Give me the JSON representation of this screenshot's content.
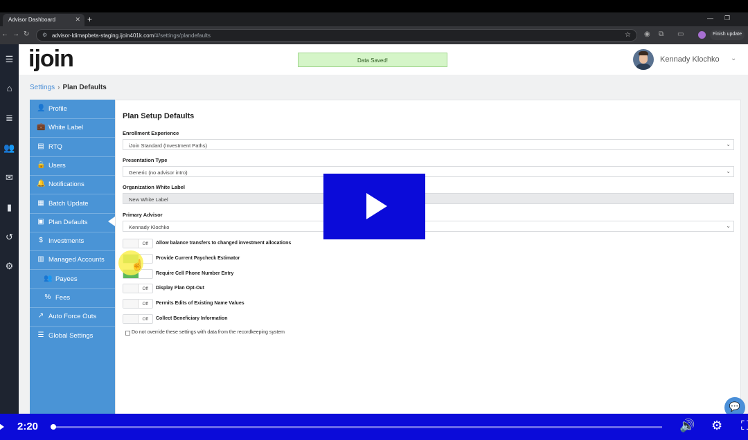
{
  "browser": {
    "tab_title": "Advisor Dashboard",
    "url_host": "advisor-ldimapbeta-staging.ijoin401k.com",
    "url_path": "/#/settings/plandefaults",
    "finish_update": "Finish update"
  },
  "header": {
    "logo": "ijoin",
    "toast": "Data Saved!",
    "user_name": "Kennady Klochko"
  },
  "breadcrumb": {
    "parent": "Settings",
    "separator": "›",
    "current": "Plan Defaults"
  },
  "sidebar": {
    "items": [
      {
        "label": "Profile",
        "icon": "person-icon",
        "glyph": "👤"
      },
      {
        "label": "White Label",
        "icon": "briefcase-icon",
        "glyph": "💼"
      },
      {
        "label": "RTQ",
        "icon": "list-icon",
        "glyph": "▤"
      },
      {
        "label": "Users",
        "icon": "lock-icon",
        "glyph": "🔒"
      },
      {
        "label": "Notifications",
        "icon": "bell-icon",
        "glyph": "🔔"
      },
      {
        "label": "Batch Update",
        "icon": "grid-icon",
        "glyph": "▦"
      },
      {
        "label": "Plan Defaults",
        "icon": "file-icon",
        "glyph": "▣"
      },
      {
        "label": "Investments",
        "icon": "dollar-icon",
        "glyph": "$"
      },
      {
        "label": "Managed Accounts",
        "icon": "bar-chart-icon",
        "glyph": "▥"
      },
      {
        "label": "Payees",
        "icon": "users-icon",
        "glyph": "👥"
      },
      {
        "label": "Fees",
        "icon": "percent-icon",
        "glyph": "%"
      },
      {
        "label": "Auto Force Outs",
        "icon": "external-link-icon",
        "glyph": "↗"
      },
      {
        "label": "Global Settings",
        "icon": "sliders-icon",
        "glyph": "☰"
      }
    ]
  },
  "form": {
    "title": "Plan Setup Defaults",
    "enrollment_label": "Enrollment Experience",
    "enrollment_value": "iJoin Standard (Investment Paths)",
    "presentation_label": "Presentation Type",
    "presentation_value": "Generic (no advisor intro)",
    "white_label_label": "Organization White Label",
    "white_label_value": "New White Label",
    "advisor_label": "Primary Advisor",
    "advisor_value": "Kennady Klochko",
    "off_text": "Off",
    "toggles": [
      {
        "label": "Allow balance transfers to changed investment allocations",
        "state": "off"
      },
      {
        "label": "Provide Current Paycheck Estimator",
        "state": "on"
      },
      {
        "label": "Require Cell Phone Number Entry",
        "state": "on"
      },
      {
        "label": "Display Plan Opt-Out",
        "state": "off"
      },
      {
        "label": "Permits Edits of Existing Name Values",
        "state": "off"
      },
      {
        "label": "Collect Beneficiary Information",
        "state": "off"
      }
    ],
    "override_checkbox": "Do not override these settings with data from the recordkeeping system"
  },
  "video": {
    "time": "2:20",
    "progress": 0.003
  }
}
